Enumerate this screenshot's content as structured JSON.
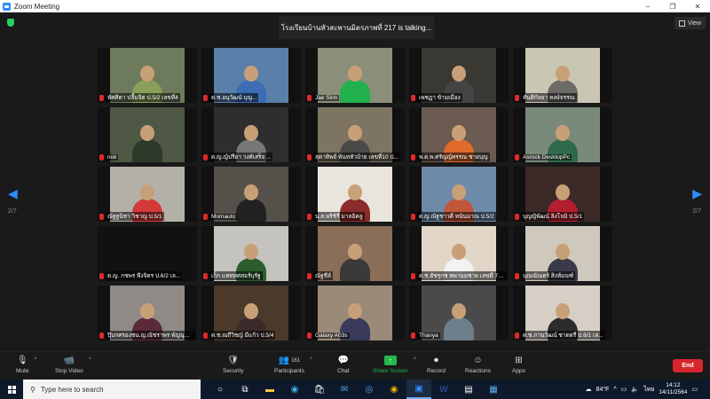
{
  "window": {
    "title": "Zoom Meeting",
    "controls": [
      "–",
      "❐",
      "✕"
    ]
  },
  "banner": {
    "talking": "โรงเรียนบ้านหัวสะพานมิตรภาพที่ 217 is  talking..."
  },
  "view_button": {
    "label": "View"
  },
  "nav": {
    "left_page": "2/7",
    "right_page": "2/7"
  },
  "tiles": [
    {
      "name": "ทัศศิตา  ปลื้มจิต ป.5/2  เลขที่4",
      "muted": true,
      "bg": "#6d7a5c",
      "shirt": "#8aa05a",
      "video": true
    },
    {
      "name": "ด.ช.อนุวัฒน์  บุญ...",
      "muted": true,
      "bg": "#5a7fa8",
      "shirt": "#3b6cb4",
      "video": true
    },
    {
      "name": "Jae Sirin",
      "muted": true,
      "bg": "#8a8f7a",
      "shirt": "#22b14c",
      "video": true
    },
    {
      "name": "เพชฏา  ข้ามเมือง",
      "muted": true,
      "bg": "#3a3832",
      "shirt": "#444",
      "video": true
    },
    {
      "name": "ทันศิกัลยา  หงษ์จรรณ",
      "muted": true,
      "bg": "#c9c6b4",
      "shirt": "#6d6b66",
      "video": true
    },
    {
      "name": "nok",
      "muted": true,
      "bg": "#4f5745",
      "shirt": "#2c3a2a",
      "video": true
    },
    {
      "name": "ด.ญ.ญ์ปรียา  วงศ์เสร็จ ...",
      "muted": true,
      "bg": "#2e2e2e",
      "shirt": "#777",
      "video": true
    },
    {
      "name": "สุดาทิพย์  พันทหัวบ้าย  เลขที่10  ป...",
      "muted": true,
      "bg": "#7d7462",
      "shirt": "#4c4a48",
      "video": true
    },
    {
      "name": "พ.ด.พ.ศรัญญ์ทรรณ ชายบุญ",
      "muted": true,
      "bg": "#6b5a50",
      "shirt": "#e06b2a",
      "video": true
    },
    {
      "name": "Asrock  DesktopPc",
      "muted": true,
      "bg": "#7a8a7a",
      "shirt": "#2f6a4a",
      "video": true
    },
    {
      "name": "ณัฐฐนิชา  วิชาญ  ป.5/1",
      "muted": true,
      "bg": "#b3b0a8",
      "shirt": "#d43a3a",
      "video": true
    },
    {
      "name": "Momauto",
      "muted": true,
      "bg": "#56504a",
      "shirt": "#222",
      "video": true
    },
    {
      "name": "น.ส.พริชิรี  มาลอิคลู",
      "muted": true,
      "bg": "#e9e4dc",
      "shirt": "#8b2b2b",
      "video": true
    },
    {
      "name": "ด.ญ.ณัฐชาวดี  หนันมาณ  ป.5/2",
      "muted": true,
      "bg": "#6d8aa8",
      "shirt": "#c1573a",
      "video": true
    },
    {
      "name": "บุญญิพัฒน์  ลิงโจมิ  ป.5/1",
      "muted": true,
      "bg": "#3c2a28",
      "shirt": "#b31f2f",
      "video": true
    },
    {
      "name": "ด.ญ.  กชพร  พึงจิตร  ป.6/2  เล...",
      "muted": true,
      "bg": "#1a1a1a",
      "shirt": "#1a1a1a",
      "video": false
    },
    {
      "name": "เก็ก  แทททศสอร์บุรัฐ",
      "muted": true,
      "bg": "#c5c3bd",
      "shirt": "#2b5d2f",
      "video": true
    },
    {
      "name": "ณัฐชีล์",
      "muted": true,
      "bg": "#8a6e58",
      "shirt": "#3a3a3a",
      "video": true
    },
    {
      "name": "ด.ช.ฮัชรุกช หพามมชาย  เลขที่ 7  ป...",
      "muted": true,
      "bg": "#e1d6c8",
      "shirt": "#f2f2f2",
      "video": true
    },
    {
      "name": "บุณณัณตร์  สิงห์มนฑ์",
      "muted": true,
      "bg": "#cfc8bd",
      "shirt": "#3b3a48",
      "video": true
    },
    {
      "name": "ปุ๊บกศรองชน.ญ.ณัชราพร  พัญนุต  6...",
      "muted": true,
      "bg": "#8f8a86",
      "shirt": "#5a2a3a",
      "video": true
    },
    {
      "name": "ด.ช.ณถึวิชญ์ มีแก้ว  ป.5/4",
      "muted": true,
      "bg": "#4b3a2c",
      "shirt": "#3a2a2a",
      "video": true
    },
    {
      "name": "Galaxy A03s",
      "muted": true,
      "bg": "#9b8a78",
      "shirt": "#3a3a5a",
      "video": true
    },
    {
      "name": "Thanya",
      "muted": true,
      "bg": "#4a4a4a",
      "shirt": "#6d7f8a",
      "video": true
    },
    {
      "name": "ด.ช.ภานวัฒน์  ชาดตรี  ป.6/1  เล...",
      "muted": true,
      "bg": "#d6cfc5",
      "shirt": "#2c2c2c",
      "video": true
    }
  ],
  "toolbar": {
    "mute": "Mute",
    "stop_video": "Stop Video",
    "security": "Security",
    "participants": "Participants",
    "participants_count": "161",
    "chat": "Chat",
    "share_screen": "Share Screen",
    "record": "Record",
    "reactions": "Reactions",
    "apps": "Apps",
    "end": "End"
  },
  "taskbar": {
    "search_placeholder": "Type here to search",
    "weather": "84°F",
    "lang": "ไทย",
    "time": "14:12",
    "date": "14/11/2564"
  }
}
